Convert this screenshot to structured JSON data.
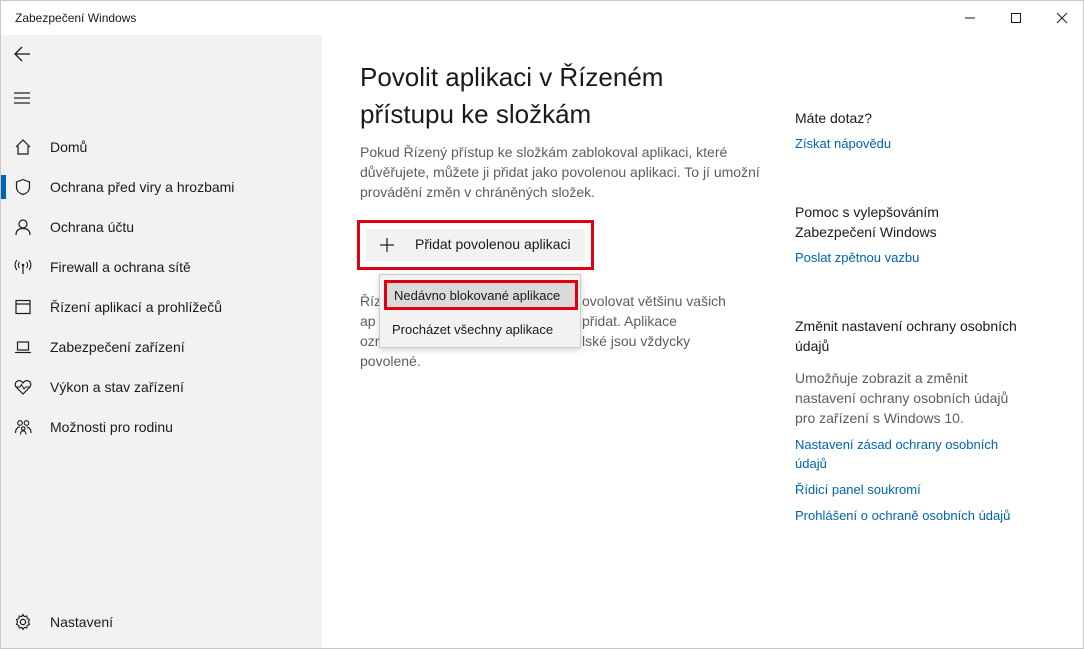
{
  "window": {
    "title": "Zabezpečení Windows"
  },
  "sidebar": {
    "items": [
      {
        "label": "Domů",
        "icon": "home-icon"
      },
      {
        "label": "Ochrana před viry a hrozbami",
        "icon": "shield-icon",
        "active": true
      },
      {
        "label": "Ochrana účtu",
        "icon": "person-icon"
      },
      {
        "label": "Firewall a ochrana sítě",
        "icon": "antenna-icon"
      },
      {
        "label": "Řízení aplikací a prohlížečů",
        "icon": "app-window-icon"
      },
      {
        "label": "Zabezpečení zařízení",
        "icon": "laptop-icon"
      },
      {
        "label": "Výkon a stav zařízení",
        "icon": "heart-pulse-icon"
      },
      {
        "label": "Možnosti pro rodinu",
        "icon": "family-icon"
      }
    ],
    "settings_label": "Nastavení"
  },
  "main": {
    "title": "Povolit aplikaci v Řízeném přístupu ke složkám",
    "description": "Pokud Řízený přístup ke složkám zablokoval aplikaci, které důvěřujete, můžete ji přidat jako povolenou aplikaci. To jí umožní provádění změn v chráněných složek.",
    "add_button_label": "Přidat povolenou aplikaci",
    "body_lines": [
      "Říz",
      "ap",
      "ozr",
      "povolené."
    ],
    "body_lines_right": [
      "ovolovat většinu vašich",
      "přidat. Aplikace",
      "lské jsou vždycky"
    ],
    "menu": {
      "items": [
        "Nedávno blokované aplikace",
        "Procházet všechny aplikace"
      ]
    }
  },
  "right": {
    "question_heading": "Máte dotaz?",
    "help_link": "Získat nápovědu",
    "improve_heading": "Pomoc s vylepšováním Zabezpečení Windows",
    "feedback_link": "Poslat zpětnou vazbu",
    "privacy_heading": "Změnit nastavení ochrany osobních údajů",
    "privacy_text": "Umožňuje zobrazit a změnit nastavení ochrany osobních údajů pro zařízení s Windows 10.",
    "privacy_links": [
      "Nastavení zásad ochrany osobních údajů",
      "Řídicí panel soukromí",
      "Prohlášení o ochraně osobních údajů"
    ]
  },
  "colors": {
    "accent": "#0063b1",
    "highlight_border": "#e0000f",
    "sidebar_bg": "#f2f2f2"
  }
}
